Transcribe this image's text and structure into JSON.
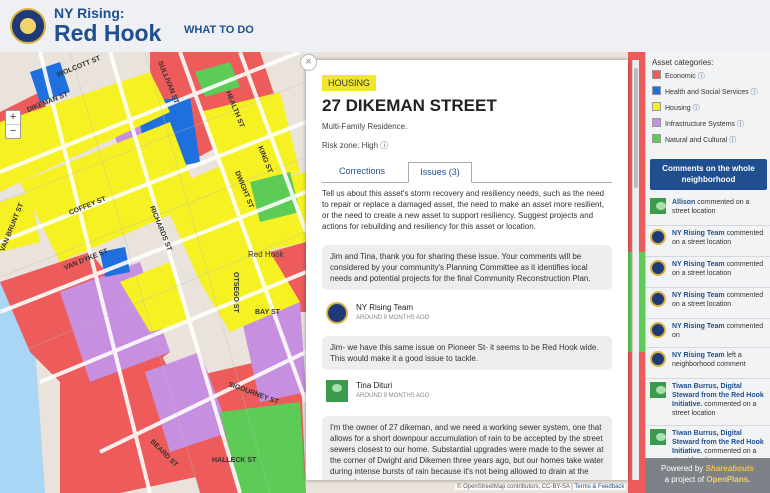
{
  "header": {
    "brand_line1": "NY Rising:",
    "brand_line2": "Red Hook",
    "nav_what_to_do": "WHAT TO DO"
  },
  "map": {
    "streets": [
      "WOLCOTT ST",
      "DIKEMAN ST",
      "VAN BRUNT ST",
      "COFFEY ST",
      "VAN DYKE ST",
      "RICHARDS ST",
      "DWIGHT ST",
      "BEARD ST",
      "HALLECK ST",
      "SIGOURNEY ST",
      "BAY ST",
      "OTSEGO ST",
      "SULLIVAN ST",
      "HEALTH ST",
      "KING ST",
      "Red Hook"
    ],
    "zoom_in": "+",
    "zoom_out": "−",
    "attribution_prefix": "© OpenStreetMap contributors, CC-BY-SA",
    "attribution_link": "Terms & Feedback",
    "colors": {
      "economic": "#ee5b5b",
      "health": "#1f6fdf",
      "housing": "#f5f122",
      "infrastructure": "#c78fe0",
      "natural": "#5ccc57"
    }
  },
  "panel": {
    "close_label": "×",
    "category_tag": "HOUSING",
    "title": "27 DIKEMAN STREET",
    "subtitle": "Multi-Family Residence.",
    "risk_zone": "Risk zone: High ⓘ",
    "tabs": [
      "Corrections",
      "Issues (3)"
    ],
    "intro": "Tell us about this asset's storm recovery and resiliency needs, such as the need to repair or replace a damaged asset, the need to make an asset more resilient, or the need to create a new asset to support resiliency. Suggest projects and actions for rebuilding and resiliency for this asset or location.",
    "comments": [
      {
        "text": "Jim and Tina, thank you for sharing these issue. Your comments will be considered by your community's Planning Committee as it identifies local needs and potential projects for the final Community Reconstruction Plan.",
        "author": "NY Rising Team",
        "time": "AROUND 9 MONTHS AGO"
      },
      {
        "text": "Jim- we have this same issue on Pioneer St- it seems to be Red Hook wide. This would make it a good issue to tackle.",
        "author": "Tina Dituri",
        "time": "AROUND 9 MONTHS AGO"
      },
      {
        "text": "I'm the owner of 27 dikeman, and we need a working sewer system, one that allows for a short downpour accumulation of rain to be accepted by the street sewers closest to our home. Substantial upgrades were made to the sewer at the corner of Dwight and Dikemen three years ago, but our homes take water during intense bursts of rain because it's not being allowed to drain at the corner.)"
      }
    ]
  },
  "sidebar": {
    "legend_title": "Asset categories:",
    "legend": [
      {
        "label": "Economic",
        "color": "#ee5b5b"
      },
      {
        "label": "Health and Social Services",
        "color": "#1f6fdf"
      },
      {
        "label": "Housing",
        "color": "#f5f122"
      },
      {
        "label": "Infrastructure Systems",
        "color": "#c78fe0"
      },
      {
        "label": "Natural and Cultural",
        "color": "#5ccc57"
      }
    ],
    "info_glyph": "ⓘ",
    "cta": "Comments on the whole neighborhood",
    "feed": [
      {
        "name": "Allison",
        "action": "commented on a street location",
        "avatar": "user"
      },
      {
        "name": "NY Rising Team",
        "action": "commented on a street location",
        "avatar": "seal"
      },
      {
        "name": "NY Rising Team",
        "action": "commented on a street location",
        "avatar": "seal"
      },
      {
        "name": "NY Rising Team",
        "action": "commented on a street location",
        "avatar": "seal"
      },
      {
        "name": "NY Rising Team",
        "action": "commented on",
        "avatar": "seal"
      },
      {
        "name": "NY Rising Team",
        "action": "left a neighborhood comment",
        "avatar": "seal"
      },
      {
        "name": "Tiwan Burrus, Digital Steward from the Red Hook Initiative.",
        "action": "commented on a street location",
        "avatar": "user"
      },
      {
        "name": "Tiwan Burrus, Digital Steward from the Red Hook Initiative.",
        "action": "commented on a street location",
        "avatar": "user"
      }
    ],
    "footer_powered": "Powered by",
    "footer_shareabouts": "Shareabouts",
    "footer_project": "a project of",
    "footer_openplans": "OpenPlans."
  }
}
